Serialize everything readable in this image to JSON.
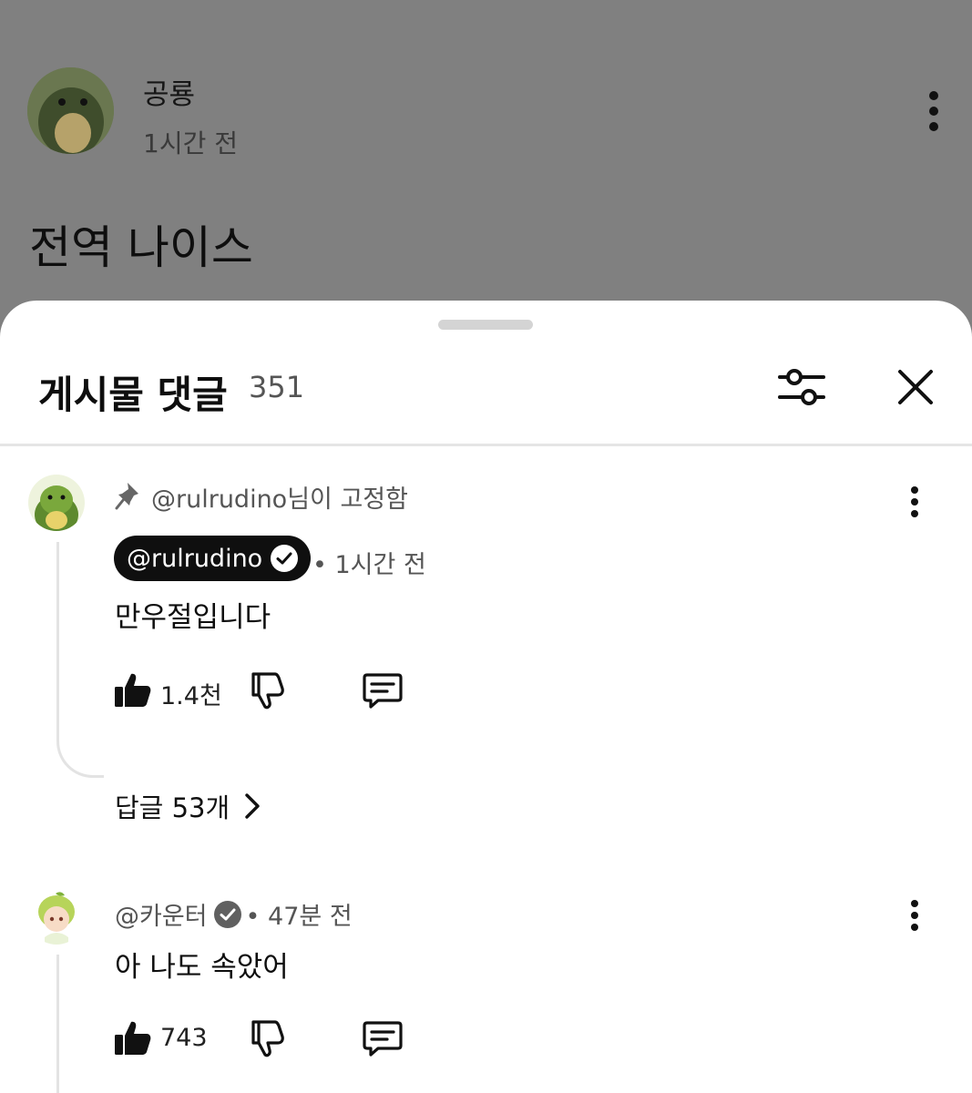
{
  "post": {
    "author": "공룡",
    "time": "1시간 전",
    "title": "전역 나이스"
  },
  "sheet": {
    "title": "게시물 댓글",
    "count": "351"
  },
  "comments": [
    {
      "pinned_text": "@rulrudino님이 고정함",
      "author": "@rulrudino",
      "time": "• 1시간 전",
      "text": "만우절입니다",
      "likes": "1.4천",
      "replies_label": "답글 53개"
    },
    {
      "author": "@카운터",
      "time": "• 47분 전",
      "text": "아 나도 속았어",
      "likes": "743"
    }
  ],
  "colors": {
    "overlay": "#808080",
    "sheet": "#ffffff",
    "chip": "#0f0f0f"
  }
}
